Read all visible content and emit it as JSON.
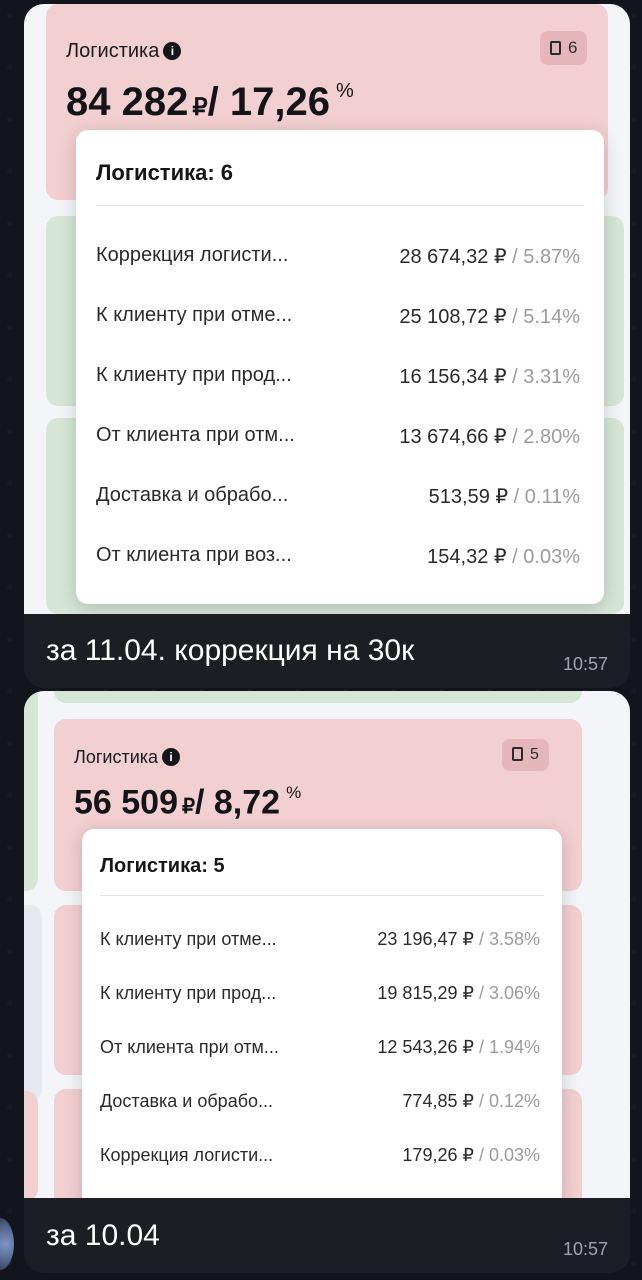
{
  "messages": [
    {
      "card": {
        "title": "Логистика",
        "badge_count": "6",
        "amount": "84 282",
        "currency": "₽",
        "percent": "/ 17,26",
        "percent_sign": "%"
      },
      "popup": {
        "title": "Логистика: 6",
        "rows": [
          {
            "name": "Коррекция логисти...",
            "amount": "28 674,32 ₽",
            "pct": "/ 5.87%"
          },
          {
            "name": "К клиенту при отме...",
            "amount": "25 108,72 ₽",
            "pct": "/ 5.14%"
          },
          {
            "name": "К клиенту при прод...",
            "amount": "16 156,34 ₽",
            "pct": "/ 3.31%"
          },
          {
            "name": "От клиента при отм...",
            "amount": "13 674,66 ₽",
            "pct": "/ 2.80%"
          },
          {
            "name": "Доставка и обрабо...",
            "amount": "513,59 ₽",
            "pct": "/ 0.11%"
          },
          {
            "name": "От клиента при воз...",
            "amount": "154,32 ₽",
            "pct": "/ 0.03%"
          }
        ]
      },
      "caption": "за 11.04. коррекция на 30к",
      "time": "10:57"
    },
    {
      "card": {
        "title": "Логистика",
        "badge_count": "5",
        "amount": "56 509",
        "currency": "₽",
        "percent": "/ 8,72",
        "percent_sign": "%"
      },
      "popup": {
        "title": "Логистика: 5",
        "rows": [
          {
            "name": "К клиенту при отме...",
            "amount": "23 196,47 ₽",
            "pct": "/ 3.58%"
          },
          {
            "name": "К клиенту при прод...",
            "amount": "19 815,29 ₽",
            "pct": "/ 3.06%"
          },
          {
            "name": "От клиента при отм...",
            "amount": "12 543,26 ₽",
            "pct": "/ 1.94%"
          },
          {
            "name": "Доставка и обрабо...",
            "amount": "774,85 ₽",
            "pct": "/ 0.12%"
          },
          {
            "name": "Коррекция логисти...",
            "amount": "179,26 ₽",
            "pct": "/ 0.03%"
          }
        ]
      },
      "caption": "за 10.04",
      "time": "10:57"
    }
  ]
}
